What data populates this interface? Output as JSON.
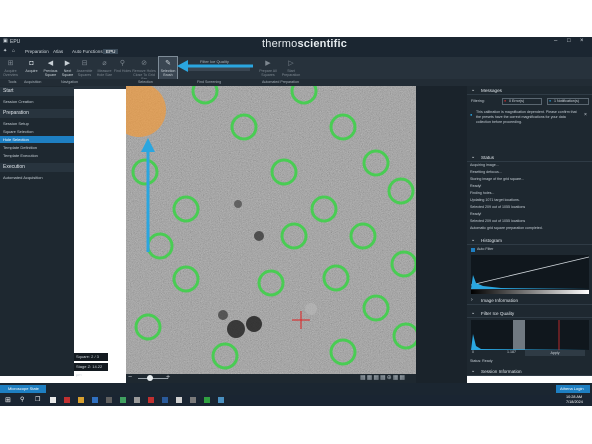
{
  "window": {
    "app_title": "EPU",
    "brand_prefix": "thermo",
    "brand_suffix": "scientific"
  },
  "menu": [
    "Preparation",
    "Atlas",
    "Auto Functions",
    "EPU"
  ],
  "toolbar": {
    "buttons": [
      {
        "label": "Acquire Overview",
        "icon": "overview-icon"
      },
      {
        "label": "Acquire",
        "icon": "camera-icon"
      },
      {
        "label": "Previous Square",
        "icon": "arrow-left-icon"
      },
      {
        "label": "Next Square",
        "icon": "arrow-right-icon"
      },
      {
        "label": "Assemble Squares",
        "icon": "assemble-icon"
      },
      {
        "label": "Measure Hole Size",
        "icon": "measure-icon"
      },
      {
        "label": "Find Holes",
        "icon": "search-icon"
      },
      {
        "label": "Remove Holes Close To Grid Bar",
        "icon": "remove-icon"
      },
      {
        "label": "Selection Brush",
        "icon": "brush-icon"
      }
    ],
    "filter_label": "Filter Ice Quality",
    "prepare_buttons": [
      "Prepare All Squares",
      "Start Preparation"
    ],
    "sections": [
      "Tools",
      "Acquisition",
      "Navigation",
      "Selection",
      "Find Screening",
      "Automated Preparation"
    ]
  },
  "left_panel": {
    "start": {
      "title": "Start",
      "items": [
        "Session Creation"
      ]
    },
    "preparation": {
      "title": "Preparation",
      "items": [
        "Session Setup",
        "Square Selection",
        "Hole Selection",
        "Template Definition",
        "Template Execution"
      ]
    },
    "execution": {
      "title": "Execution",
      "items": [
        "Automated Acquisition"
      ]
    },
    "square_label": "Square: 2 / 3",
    "stage_label": "Stage Z: 14.22 µm"
  },
  "right_panel": {
    "messages": {
      "title": "Messages",
      "filtering_label": "Filtering:",
      "errors_label": "0 Error(s)",
      "notifications_label": "1 Notification(s)",
      "notification_text": "This calibration is magnification dependent. Please confirm that the presets have the correct magnifications for your data collection before proceeding."
    },
    "status": {
      "title": "Status",
      "lines": [
        "Acquiring image...",
        "Resetting defocus...",
        "Storing image of the grid square...",
        "Ready!",
        "Finding holes...",
        "Updating 1071 target locations.",
        "Selected 209 out of 1055 locations",
        "Ready!",
        "Selected 209 out of 1055 locations",
        "Automatic grid square preparation completed."
      ]
    },
    "histogram": {
      "title": "Histogram",
      "auto_filter": "Auto Filter"
    },
    "image_information": "Image Information",
    "filter_ice_quality": {
      "title": "Filter Ice Quality",
      "value_low": "0",
      "value_mid": "1.187",
      "apply_label": "Apply",
      "status": "Status: Ready"
    },
    "session_information": "Session Information"
  },
  "bottom_bar": {
    "microscope_state": "Microscope State",
    "login": "Athena Login"
  },
  "taskbar": {
    "time": "10:28 AM",
    "date": "7/18/2024"
  },
  "colors": {
    "accent": "#1e7fc2",
    "hole_green": "#3fd04a",
    "arrow_blue": "#2aa6e0",
    "selected_orange": "#ff9a2a"
  }
}
